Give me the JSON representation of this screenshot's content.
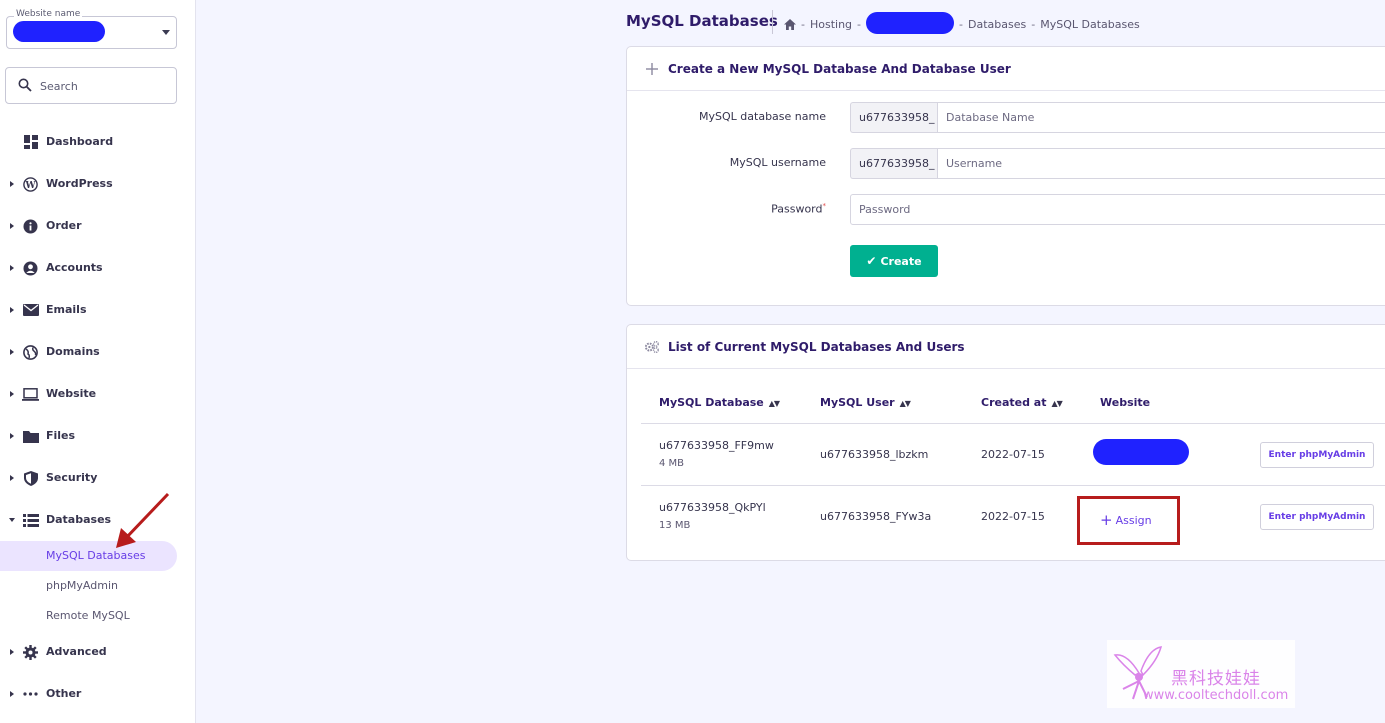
{
  "sidebar": {
    "site_select": {
      "caption": "Website name"
    },
    "search": {
      "placeholder": "Search"
    },
    "items": [
      {
        "label": "Dashboard",
        "icon": "dashboard-icon",
        "arrow": "none"
      },
      {
        "label": "WordPress",
        "icon": "wordpress-icon",
        "arrow": "right"
      },
      {
        "label": "Order",
        "icon": "info-icon",
        "arrow": "right"
      },
      {
        "label": "Accounts",
        "icon": "account-icon",
        "arrow": "right"
      },
      {
        "label": "Emails",
        "icon": "email-icon",
        "arrow": "right"
      },
      {
        "label": "Domains",
        "icon": "globe-icon",
        "arrow": "right"
      },
      {
        "label": "Website",
        "icon": "laptop-icon",
        "arrow": "right"
      },
      {
        "label": "Files",
        "icon": "folder-icon",
        "arrow": "right"
      },
      {
        "label": "Security",
        "icon": "shield-icon",
        "arrow": "right"
      },
      {
        "label": "Databases",
        "icon": "database-icon",
        "arrow": "down"
      },
      {
        "label": "Advanced",
        "icon": "gear-icon",
        "arrow": "right"
      },
      {
        "label": "Other",
        "icon": "more-icon",
        "arrow": "right"
      }
    ],
    "database_sub": [
      "MySQL Databases",
      "phpMyAdmin",
      "Remote MySQL"
    ]
  },
  "header": {
    "title": "MySQL Databases",
    "breadcrumb": {
      "home_icon": "home-icon",
      "hosting": "Hosting",
      "databases": "Databases",
      "current": "MySQL Databases",
      "separator": "-"
    }
  },
  "create_card": {
    "title": "Create a New MySQL Database And Database User",
    "db_name_label": "MySQL database name",
    "db_name_prefix": "u677633958_",
    "db_name_placeholder": "Database Name",
    "username_label": "MySQL username",
    "username_prefix": "u677633958_",
    "username_placeholder": "Username",
    "password_label": "Password",
    "password_placeholder": "Password",
    "create_label": "Create"
  },
  "list_card": {
    "title": "List of Current MySQL Databases And Users",
    "columns": [
      "MySQL Database",
      "MySQL User",
      "Created at",
      "Website"
    ],
    "rows": [
      {
        "database": "u677633958_FF9mw",
        "size": "4 MB",
        "user": "u677633958_lbzkm",
        "created": "2022-07-15",
        "website": "",
        "action": "Enter phpMyAdmin"
      },
      {
        "database": "u677633958_QkPYl",
        "size": "13 MB",
        "user": "u677633958_FYw3a",
        "created": "2022-07-15",
        "website_action": "Assign",
        "action": "Enter phpMyAdmin"
      }
    ]
  },
  "watermark": {
    "cn": "黑科技娃娃",
    "url": "www.cooltechdoll.com"
  },
  "colors": {
    "accent": "#673de6",
    "create_green": "#00b090",
    "highlight_red": "#b71c1c",
    "redaction_blue": "#1f22ff"
  }
}
